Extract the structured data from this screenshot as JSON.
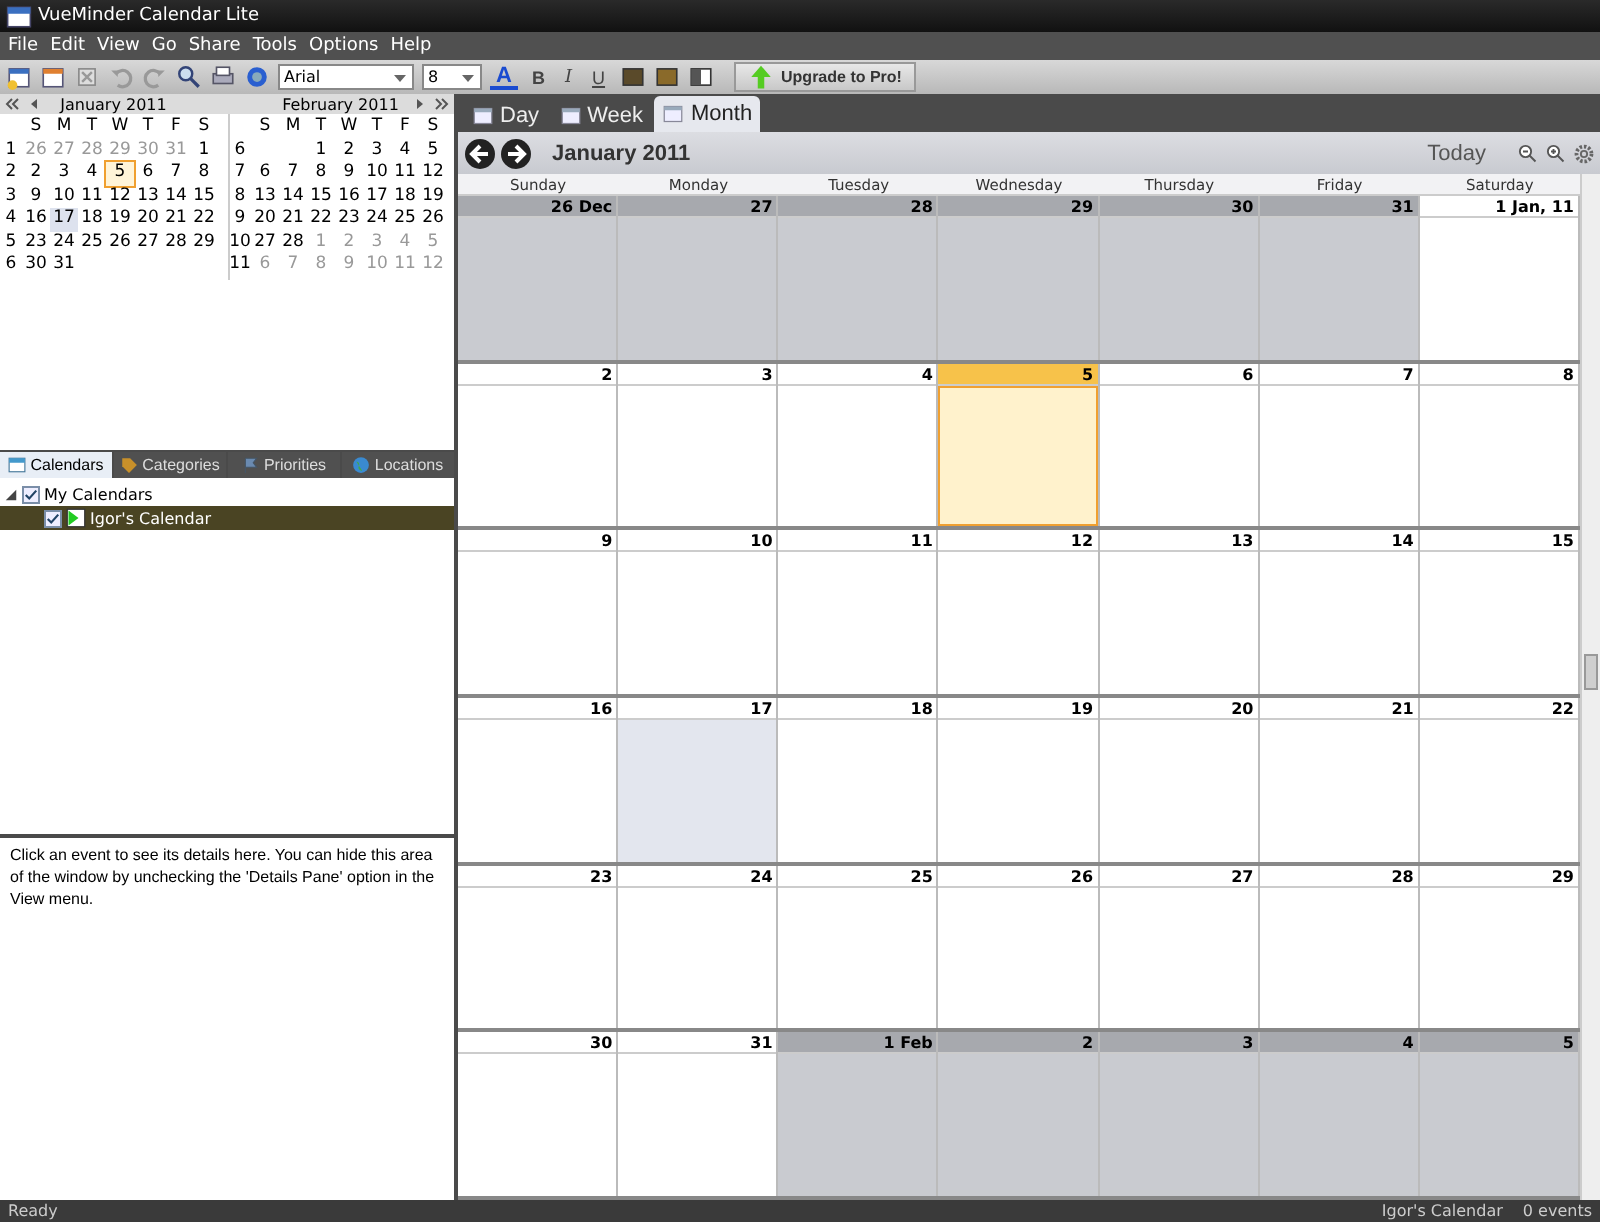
{
  "window": {
    "title": "VueMinder Calendar Lite"
  },
  "menu": [
    "File",
    "Edit",
    "View",
    "Go",
    "Share",
    "Tools",
    "Options",
    "Help"
  ],
  "toolbar": {
    "font": "Arial",
    "size": "8",
    "format": [
      {
        "kind": "color",
        "label": "A"
      },
      {
        "kind": "bold",
        "label": "B"
      },
      {
        "kind": "italic",
        "label": "I"
      },
      {
        "kind": "underline",
        "label": "U"
      }
    ],
    "upgrade": "Upgrade to Pro!"
  },
  "mini_calendars": [
    {
      "title": "January 2011",
      "weekdays": [
        "S",
        "M",
        "T",
        "W",
        "T",
        "F",
        "S"
      ],
      "weeks": [
        {
          "number": "1",
          "days": [
            {
              "label": "26",
              "other_month": true,
              "today": false,
              "selected": false
            },
            {
              "label": "27",
              "other_month": true,
              "today": false,
              "selected": false
            },
            {
              "label": "28",
              "other_month": true,
              "today": false,
              "selected": false
            },
            {
              "label": "29",
              "other_month": true,
              "today": false,
              "selected": false
            },
            {
              "label": "30",
              "other_month": true,
              "today": false,
              "selected": false
            },
            {
              "label": "31",
              "other_month": true,
              "today": false,
              "selected": false
            },
            {
              "label": "1",
              "other_month": false,
              "today": false,
              "selected": false
            }
          ]
        },
        {
          "number": "2",
          "days": [
            {
              "label": "2",
              "other_month": false,
              "today": false,
              "selected": false
            },
            {
              "label": "3",
              "other_month": false,
              "today": false,
              "selected": false
            },
            {
              "label": "4",
              "other_month": false,
              "today": false,
              "selected": false
            },
            {
              "label": "5",
              "other_month": false,
              "today": true,
              "selected": false
            },
            {
              "label": "6",
              "other_month": false,
              "today": false,
              "selected": false
            },
            {
              "label": "7",
              "other_month": false,
              "today": false,
              "selected": false
            },
            {
              "label": "8",
              "other_month": false,
              "today": false,
              "selected": false
            }
          ]
        },
        {
          "number": "3",
          "days": [
            {
              "label": "9",
              "other_month": false,
              "today": false,
              "selected": false
            },
            {
              "label": "10",
              "other_month": false,
              "today": false,
              "selected": false
            },
            {
              "label": "11",
              "other_month": false,
              "today": false,
              "selected": false
            },
            {
              "label": "12",
              "other_month": false,
              "today": false,
              "selected": false
            },
            {
              "label": "13",
              "other_month": false,
              "today": false,
              "selected": false
            },
            {
              "label": "14",
              "other_month": false,
              "today": false,
              "selected": false
            },
            {
              "label": "15",
              "other_month": false,
              "today": false,
              "selected": false
            }
          ]
        },
        {
          "number": "4",
          "days": [
            {
              "label": "16",
              "other_month": false,
              "today": false,
              "selected": false
            },
            {
              "label": "17",
              "other_month": false,
              "today": false,
              "selected": true
            },
            {
              "label": "18",
              "other_month": false,
              "today": false,
              "selected": false
            },
            {
              "label": "19",
              "other_month": false,
              "today": false,
              "selected": false
            },
            {
              "label": "20",
              "other_month": false,
              "today": false,
              "selected": false
            },
            {
              "label": "21",
              "other_month": false,
              "today": false,
              "selected": false
            },
            {
              "label": "22",
              "other_month": false,
              "today": false,
              "selected": false
            }
          ]
        },
        {
          "number": "5",
          "days": [
            {
              "label": "23",
              "other_month": false,
              "today": false,
              "selected": false
            },
            {
              "label": "24",
              "other_month": false,
              "today": false,
              "selected": false
            },
            {
              "label": "25",
              "other_month": false,
              "today": false,
              "selected": false
            },
            {
              "label": "26",
              "other_month": false,
              "today": false,
              "selected": false
            },
            {
              "label": "27",
              "other_month": false,
              "today": false,
              "selected": false
            },
            {
              "label": "28",
              "other_month": false,
              "today": false,
              "selected": false
            },
            {
              "label": "29",
              "other_month": false,
              "today": false,
              "selected": false
            }
          ]
        },
        {
          "number": "6",
          "days": [
            {
              "label": "30",
              "other_month": false,
              "today": false,
              "selected": false
            },
            {
              "label": "31",
              "other_month": false,
              "today": false,
              "selected": false
            }
          ]
        }
      ]
    },
    {
      "title": "February 2011",
      "weekdays": [
        "S",
        "M",
        "T",
        "W",
        "T",
        "F",
        "S"
      ],
      "weeks": [
        {
          "number": "6",
          "days": [
            {
              "label": "1",
              "other_month": false,
              "today": false,
              "selected": false
            },
            {
              "label": "2",
              "other_month": false,
              "today": false,
              "selected": false
            },
            {
              "label": "3",
              "other_month": false,
              "today": false,
              "selected": false
            },
            {
              "label": "4",
              "other_month": false,
              "today": false,
              "selected": false
            },
            {
              "label": "5",
              "other_month": false,
              "today": false,
              "selected": false
            }
          ]
        },
        {
          "number": "7",
          "days": [
            {
              "label": "6",
              "other_month": false,
              "today": false,
              "selected": false
            },
            {
              "label": "7",
              "other_month": false,
              "today": false,
              "selected": false
            },
            {
              "label": "8",
              "other_month": false,
              "today": false,
              "selected": false
            },
            {
              "label": "9",
              "other_month": false,
              "today": false,
              "selected": false
            },
            {
              "label": "10",
              "other_month": false,
              "today": false,
              "selected": false
            },
            {
              "label": "11",
              "other_month": false,
              "today": false,
              "selected": false
            },
            {
              "label": "12",
              "other_month": false,
              "today": false,
              "selected": false
            }
          ]
        },
        {
          "number": "8",
          "days": [
            {
              "label": "13",
              "other_month": false,
              "today": false,
              "selected": false
            },
            {
              "label": "14",
              "other_month": false,
              "today": false,
              "selected": false
            },
            {
              "label": "15",
              "other_month": false,
              "today": false,
              "selected": false
            },
            {
              "label": "16",
              "other_month": false,
              "today": false,
              "selected": false
            },
            {
              "label": "17",
              "other_month": false,
              "today": false,
              "selected": false
            },
            {
              "label": "18",
              "other_month": false,
              "today": false,
              "selected": false
            },
            {
              "label": "19",
              "other_month": false,
              "today": false,
              "selected": false
            }
          ]
        },
        {
          "number": "9",
          "days": [
            {
              "label": "20",
              "other_month": false,
              "today": false,
              "selected": false
            },
            {
              "label": "21",
              "other_month": false,
              "today": false,
              "selected": false
            },
            {
              "label": "22",
              "other_month": false,
              "today": false,
              "selected": false
            },
            {
              "label": "23",
              "other_month": false,
              "today": false,
              "selected": false
            },
            {
              "label": "24",
              "other_month": false,
              "today": false,
              "selected": false
            },
            {
              "label": "25",
              "other_month": false,
              "today": false,
              "selected": false
            },
            {
              "label": "26",
              "other_month": false,
              "today": false,
              "selected": false
            }
          ]
        },
        {
          "number": "10",
          "days": [
            {
              "label": "27",
              "other_month": false,
              "today": false,
              "selected": false
            },
            {
              "label": "28",
              "other_month": false,
              "today": false,
              "selected": false
            },
            {
              "label": "1",
              "other_month": true,
              "today": false,
              "selected": false
            },
            {
              "label": "2",
              "other_month": true,
              "today": false,
              "selected": false
            },
            {
              "label": "3",
              "other_month": true,
              "today": false,
              "selected": false
            },
            {
              "label": "4",
              "other_month": true,
              "today": false,
              "selected": false
            },
            {
              "label": "5",
              "other_month": true,
              "today": false,
              "selected": false
            }
          ]
        },
        {
          "number": "11",
          "days": [
            {
              "label": "6",
              "other_month": true,
              "today": false,
              "selected": false
            },
            {
              "label": "7",
              "other_month": true,
              "today": false,
              "selected": false
            },
            {
              "label": "8",
              "other_month": true,
              "today": false,
              "selected": false
            },
            {
              "label": "9",
              "other_month": true,
              "today": false,
              "selected": false
            },
            {
              "label": "10",
              "other_month": true,
              "today": false,
              "selected": false
            },
            {
              "label": "11",
              "other_month": true,
              "today": false,
              "selected": false
            },
            {
              "label": "12",
              "other_month": true,
              "today": false,
              "selected": false
            }
          ]
        }
      ]
    }
  ],
  "side_tabs": [
    {
      "label": "Calendars",
      "kind": "calendar",
      "selected": true
    },
    {
      "label": "Categories",
      "kind": "tag",
      "selected": false
    },
    {
      "label": "Priorities",
      "kind": "flag",
      "selected": false
    },
    {
      "label": "Locations",
      "kind": "globe",
      "selected": false
    }
  ],
  "tree": [
    {
      "label": "My Calendars",
      "checked": true,
      "expanded": true,
      "selected": false,
      "children": [
        {
          "label": "Igor's Calendar",
          "checked": true,
          "selected": true
        }
      ]
    }
  ],
  "details": "Click an event to see its details here. You can hide this area of the window by unchecking the 'Details Pane' option in the View menu.",
  "view_tabs": [
    {
      "label": "Day",
      "selected": false
    },
    {
      "label": "Week",
      "selected": false
    },
    {
      "label": "Month",
      "selected": true
    }
  ],
  "month": {
    "title": "January 2011",
    "today_label": "Today",
    "weekdays": [
      "Sunday",
      "Monday",
      "Tuesday",
      "Wednesday",
      "Thursday",
      "Friday",
      "Saturday"
    ],
    "weeks": [
      [
        {
          "label": "26 Dec",
          "other_month": true,
          "today": false,
          "selected": false
        },
        {
          "label": "27",
          "other_month": true,
          "today": false,
          "selected": false
        },
        {
          "label": "28",
          "other_month": true,
          "today": false,
          "selected": false
        },
        {
          "label": "29",
          "other_month": true,
          "today": false,
          "selected": false
        },
        {
          "label": "30",
          "other_month": true,
          "today": false,
          "selected": false
        },
        {
          "label": "31",
          "other_month": true,
          "today": false,
          "selected": false
        },
        {
          "label": "1 Jan, 11",
          "other_month": false,
          "today": false,
          "selected": false
        }
      ],
      [
        {
          "label": "2",
          "other_month": false,
          "today": false,
          "selected": false
        },
        {
          "label": "3",
          "other_month": false,
          "today": false,
          "selected": false
        },
        {
          "label": "4",
          "other_month": false,
          "today": false,
          "selected": false
        },
        {
          "label": "5",
          "other_month": false,
          "today": true,
          "selected": false
        },
        {
          "label": "6",
          "other_month": false,
          "today": false,
          "selected": false
        },
        {
          "label": "7",
          "other_month": false,
          "today": false,
          "selected": false
        },
        {
          "label": "8",
          "other_month": false,
          "today": false,
          "selected": false
        }
      ],
      [
        {
          "label": "9",
          "other_month": false,
          "today": false,
          "selected": false
        },
        {
          "label": "10",
          "other_month": false,
          "today": false,
          "selected": false
        },
        {
          "label": "11",
          "other_month": false,
          "today": false,
          "selected": false
        },
        {
          "label": "12",
          "other_month": false,
          "today": false,
          "selected": false
        },
        {
          "label": "13",
          "other_month": false,
          "today": false,
          "selected": false
        },
        {
          "label": "14",
          "other_month": false,
          "today": false,
          "selected": false
        },
        {
          "label": "15",
          "other_month": false,
          "today": false,
          "selected": false
        }
      ],
      [
        {
          "label": "16",
          "other_month": false,
          "today": false,
          "selected": false
        },
        {
          "label": "17",
          "other_month": false,
          "today": false,
          "selected": true
        },
        {
          "label": "18",
          "other_month": false,
          "today": false,
          "selected": false
        },
        {
          "label": "19",
          "other_month": false,
          "today": false,
          "selected": false
        },
        {
          "label": "20",
          "other_month": false,
          "today": false,
          "selected": false
        },
        {
          "label": "21",
          "other_month": false,
          "today": false,
          "selected": false
        },
        {
          "label": "22",
          "other_month": false,
          "today": false,
          "selected": false
        }
      ],
      [
        {
          "label": "23",
          "other_month": false,
          "today": false,
          "selected": false
        },
        {
          "label": "24",
          "other_month": false,
          "today": false,
          "selected": false
        },
        {
          "label": "25",
          "other_month": false,
          "today": false,
          "selected": false
        },
        {
          "label": "26",
          "other_month": false,
          "today": false,
          "selected": false
        },
        {
          "label": "27",
          "other_month": false,
          "today": false,
          "selected": false
        },
        {
          "label": "28",
          "other_month": false,
          "today": false,
          "selected": false
        },
        {
          "label": "29",
          "other_month": false,
          "today": false,
          "selected": false
        }
      ],
      [
        {
          "label": "30",
          "other_month": false,
          "today": false,
          "selected": false
        },
        {
          "label": "31",
          "other_month": false,
          "today": false,
          "selected": false
        },
        {
          "label": "1 Feb",
          "other_month": true,
          "today": false,
          "selected": false
        },
        {
          "label": "2",
          "other_month": true,
          "today": false,
          "selected": false
        },
        {
          "label": "3",
          "other_month": true,
          "today": false,
          "selected": false
        },
        {
          "label": "4",
          "other_month": true,
          "today": false,
          "selected": false
        },
        {
          "label": "5",
          "other_month": true,
          "today": false,
          "selected": false
        }
      ]
    ]
  },
  "status_bar": {
    "left": "Ready",
    "calendar": "Igor's Calendar",
    "events": "0 events"
  }
}
